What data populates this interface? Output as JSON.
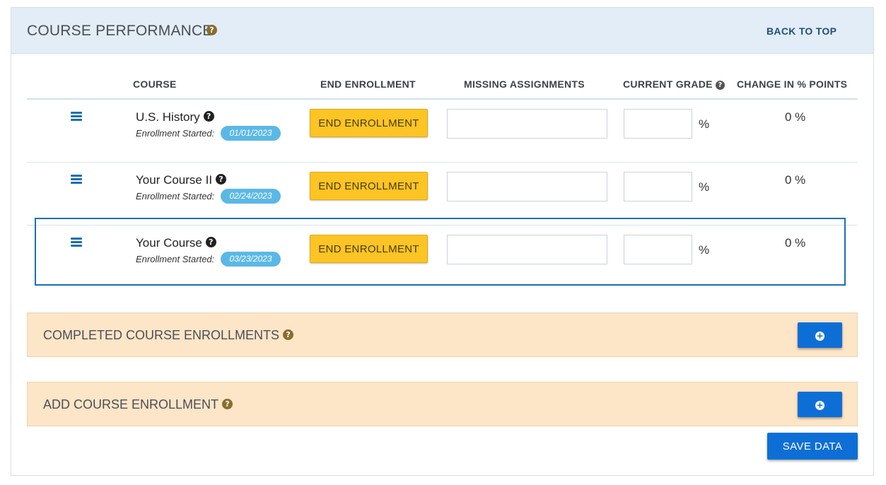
{
  "header": {
    "title": "COURSE PERFORMANCE",
    "help_icon": "question-circle-icon",
    "back_to_top": "BACK TO TOP"
  },
  "table": {
    "columns": {
      "course": "COURSE",
      "end_enrollment": "END ENROLLMENT",
      "missing_assignments": "MISSING ASSIGNMENTS",
      "current_grade": "CURRENT GRADE",
      "change": "CHANGE IN % POINTS"
    },
    "rows": [
      {
        "course": "U.S. History",
        "enrollment_label": "Enrollment Started:",
        "start_date": "01/01/2023",
        "end_button": "END ENROLLMENT",
        "missing_assignments": "",
        "current_grade": "",
        "percent_sign": "%",
        "change": "0 %"
      },
      {
        "course": "Your Course II",
        "enrollment_label": "Enrollment Started:",
        "start_date": "02/24/2023",
        "end_button": "END ENROLLMENT",
        "missing_assignments": "",
        "current_grade": "",
        "percent_sign": "%",
        "change": "0 %"
      },
      {
        "course": "Your Course",
        "enrollment_label": "Enrollment Started:",
        "start_date": "03/23/2023",
        "end_button": "END ENROLLMENT",
        "missing_assignments": "",
        "current_grade": "",
        "percent_sign": "%",
        "change": "0 %"
      }
    ]
  },
  "sections": {
    "completed": {
      "title": "COMPLETED COURSE ENROLLMENTS",
      "button_icon": "plus-circle-icon"
    },
    "add": {
      "title": "ADD COURSE ENROLLMENT",
      "button_icon": "plus-circle-icon"
    }
  },
  "save_button": "SAVE DATA",
  "colors": {
    "header_bg": "#e2edf7",
    "section_bg": "#fde5c7",
    "end_button": "#fcc424",
    "primary_button": "#0d6fd6",
    "date_pill": "#5bb8e6",
    "selection_outline": "#1b6fb5"
  }
}
